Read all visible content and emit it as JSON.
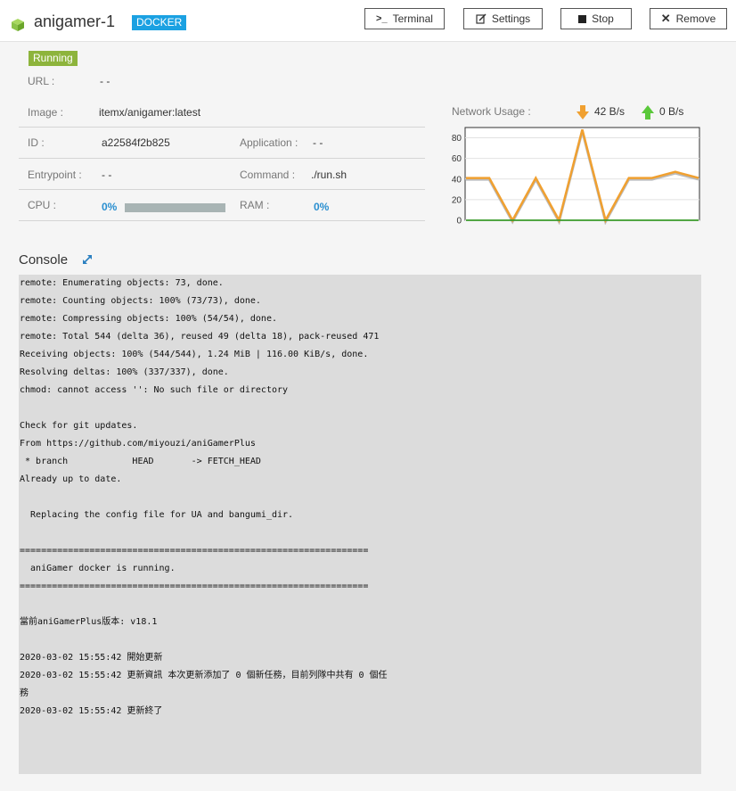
{
  "header": {
    "title": "anigamer-1",
    "badge": "DOCKER",
    "buttons": {
      "terminal": "Terminal",
      "settings": "Settings",
      "stop": "Stop",
      "remove": "Remove"
    }
  },
  "status": "Running",
  "info": {
    "url_label": "URL :",
    "url_value": "- -",
    "image_label": "Image :",
    "image_value": "itemx/anigamer:latest",
    "id_label": "ID :",
    "id_value": "a22584f2b825",
    "application_label": "Application :",
    "application_value": "- -",
    "entrypoint_label": "Entrypoint :",
    "entrypoint_value": "- -",
    "command_label": "Command :",
    "command_value": "./run.sh",
    "cpu_label": "CPU :",
    "cpu_value": "0%",
    "ram_label": "RAM :",
    "ram_value": "0%"
  },
  "network": {
    "label": "Network Usage :",
    "down": "42 B/s",
    "up": "0 B/s",
    "colors": {
      "down": "#f0a030",
      "up": "#3a9a2a"
    }
  },
  "chart_data": {
    "type": "line",
    "ylim": [
      0,
      90
    ],
    "yticks": [
      "0",
      "20",
      "40",
      "60",
      "80"
    ],
    "series": [
      {
        "values": [
          41,
          41,
          0,
          41,
          0,
          88,
          0,
          41,
          41,
          47,
          41
        ]
      },
      {
        "values": [
          0,
          0,
          0,
          0,
          0,
          0,
          0,
          0,
          0,
          0,
          0
        ]
      }
    ]
  },
  "console": {
    "title": "Console",
    "lines": [
      "remote: Enumerating objects: 73, done.",
      "remote: Counting objects: 100% (73/73), done.",
      "remote: Compressing objects: 100% (54/54), done.",
      "remote: Total 544 (delta 36), reused 49 (delta 18), pack-reused 471",
      "Receiving objects: 100% (544/544), 1.24 MiB | 116.00 KiB/s, done.",
      "Resolving deltas: 100% (337/337), done.",
      "chmod: cannot access '': No such file or directory",
      "",
      "Check for git updates.",
      "From https://github.com/miyouzi/aniGamerPlus",
      " * branch            HEAD       -> FETCH_HEAD",
      "Already up to date.",
      "",
      "  Replacing the config file for UA and bangumi_dir.",
      "",
      "=================================================================",
      "  aniGamer docker is running.",
      "=================================================================",
      "",
      "當前aniGamerPlus版本: v18.1",
      "",
      "2020-03-02 15:55:42 開始更新",
      "2020-03-02 15:55:42 更新資訊 本次更新添加了 0 個新任務，目前列隊中共有 0 個任",
      "務",
      "2020-03-02 15:55:42 更新終了"
    ]
  }
}
